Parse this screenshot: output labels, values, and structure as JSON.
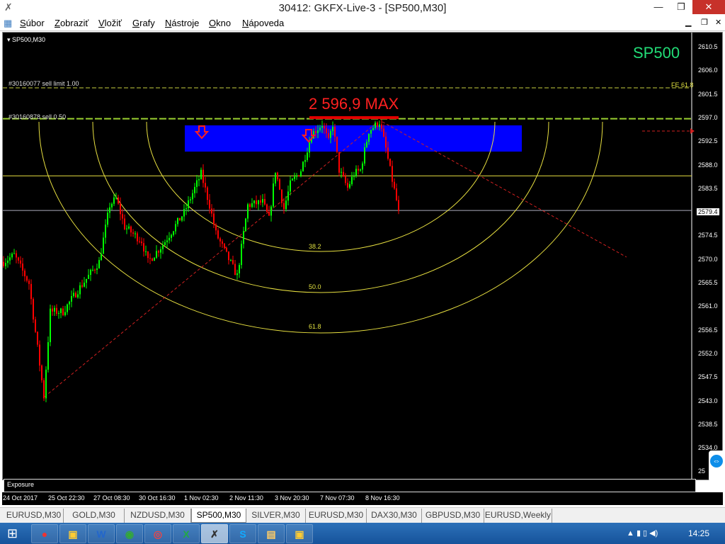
{
  "window": {
    "title": "30412: GKFX-Live-3 - [SP500,M30]",
    "minimize": "—",
    "restore": "❐",
    "close": "✕"
  },
  "menu": [
    "Súbor",
    "Zobraziť",
    "Vložiť",
    "Grafy",
    "Nástroje",
    "Okno",
    "Nápoveda"
  ],
  "chart": {
    "symbol_label": "SP500,M30",
    "watermark": "SP500",
    "watermark_color": "#22dd77",
    "max_label": "2 596,9 MAX",
    "order1": "#30160077 sell limit 1.00",
    "order2": "#30160878 sell 0.50",
    "fe_label": "FE 61.8",
    "fib_levels": [
      "38.2",
      "50.0",
      "61.8"
    ],
    "current_price": "2579.4",
    "price_ticks": [
      "2610.5",
      "2606.0",
      "2601.5",
      "2597.0",
      "2592.5",
      "2588.0",
      "2583.5",
      "2579.4",
      "2574.5",
      "2570.0",
      "2565.5",
      "2561.0",
      "2556.5",
      "2552.0",
      "2547.5",
      "2543.0",
      "2538.5",
      "2534.0",
      "25"
    ],
    "time_ticks": [
      "24 Oct 2017",
      "25 Oct 22:30",
      "27 Oct 08:30",
      "30 Oct 16:30",
      "1 Nov 02:30",
      "2 Nov 11:30",
      "3 Nov 20:30",
      "7 Nov 07:30",
      "8 Nov 16:30"
    ],
    "zone_color": "#0000ff",
    "bull_color": "#00ff00",
    "bear_color": "#ff0000",
    "price_path": [
      [
        0,
        2569.6
      ],
      [
        5,
        2570.9
      ],
      [
        12,
        2565.5
      ],
      [
        19,
        2543.9
      ],
      [
        22,
        2560.1
      ],
      [
        28,
        2560.1
      ],
      [
        35,
        2564.2
      ],
      [
        45,
        2569.6
      ],
      [
        50,
        2580.4
      ],
      [
        53,
        2581.7
      ],
      [
        57,
        2576.3
      ],
      [
        65,
        2573.6
      ],
      [
        68,
        2569.6
      ],
      [
        75,
        2572.9
      ],
      [
        85,
        2579.0
      ],
      [
        93,
        2586.4
      ],
      [
        97,
        2580.4
      ],
      [
        100,
        2575.0
      ],
      [
        105,
        2570.9
      ],
      [
        110,
        2566.9
      ],
      [
        113,
        2575.0
      ],
      [
        115,
        2580.4
      ],
      [
        122,
        2581.0
      ],
      [
        125,
        2577.7
      ],
      [
        128,
        2587.1
      ],
      [
        132,
        2579.7
      ],
      [
        135,
        2584.4
      ],
      [
        140,
        2587.1
      ],
      [
        145,
        2593.9
      ],
      [
        150,
        2595.9
      ],
      [
        153,
        2592.5
      ],
      [
        155,
        2595.9
      ],
      [
        158,
        2587.1
      ],
      [
        162,
        2583.7
      ],
      [
        165,
        2586.4
      ],
      [
        168,
        2587.1
      ],
      [
        172,
        2594.6
      ],
      [
        177,
        2596.3
      ],
      [
        180,
        2591.2
      ],
      [
        182,
        2587.1
      ],
      [
        186,
        2579.4
      ]
    ]
  },
  "exposure": {
    "title": "Exposure"
  },
  "tabs": [
    "EURUSD,M30",
    "GOLD,M30",
    "NZDUSD,M30",
    "SP500,M30",
    "SILVER,M30",
    "EURUSD,M30",
    "DAX30,M30",
    "GBPUSD,M30",
    "EURUSD,Weekly"
  ],
  "active_tab": "SP500,M30",
  "taskbar": {
    "apps": [
      "app-dots",
      "app-1",
      "Word",
      "app-3",
      "Chrome",
      "Excel",
      "MetaTrader",
      "Skype",
      "Explorer",
      "app-9"
    ],
    "clock": "14:25"
  }
}
